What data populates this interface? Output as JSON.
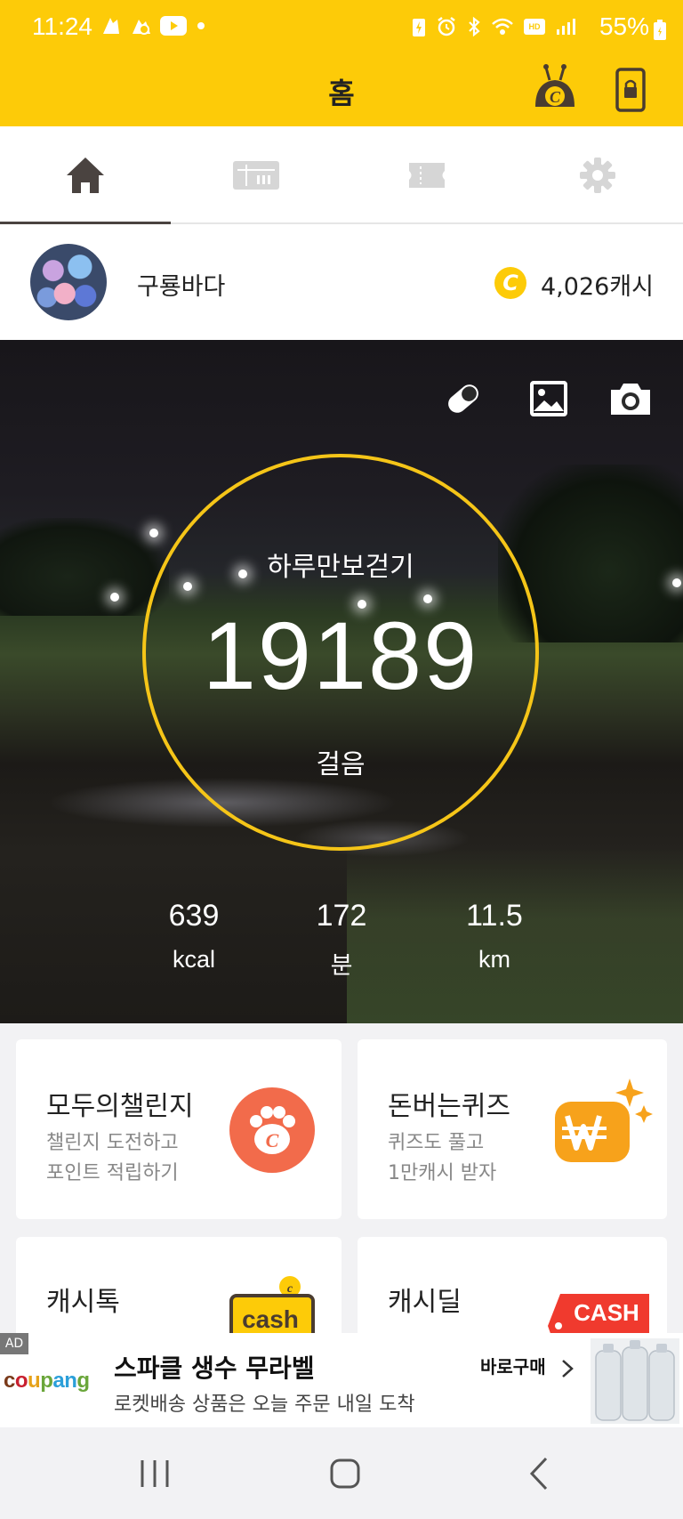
{
  "status_bar": {
    "time": "11:24",
    "battery": "55%"
  },
  "header": {
    "title": "홈"
  },
  "tabs": [
    {
      "name": "home",
      "icon": "home-icon",
      "active": true
    },
    {
      "name": "gift",
      "icon": "gift-card-icon",
      "active": false
    },
    {
      "name": "ticket",
      "icon": "ticket-icon",
      "active": false
    },
    {
      "name": "settings",
      "icon": "gear-icon",
      "active": false
    }
  ],
  "profile": {
    "username": "구룡바다",
    "coin_symbol": "C",
    "cash": "4,026캐시"
  },
  "pedometer": {
    "label": "하루만보걷기",
    "steps": "19189",
    "unit": "걸음",
    "stats": [
      {
        "value": "639",
        "unit": "kcal"
      },
      {
        "value": "172",
        "unit": "분"
      },
      {
        "value": "11.5",
        "unit": "km"
      }
    ]
  },
  "cards": [
    {
      "title": "모두의챌린지",
      "sub1": "챌린지 도전하고",
      "sub2": "포인트 적립하기"
    },
    {
      "title": "돈버는퀴즈",
      "sub1": "퀴즈도 풀고",
      "sub2": "1만캐시 받자"
    },
    {
      "title": "캐시톡",
      "sub1": "",
      "sub2": ""
    },
    {
      "title": "캐시딜",
      "sub1": "",
      "sub2": ""
    }
  ],
  "card_icons": {
    "cashtalk_text": "cash",
    "cashdeal_text": "CASH"
  },
  "ad": {
    "tag": "AD",
    "logo": "coupang",
    "title": "스파클 생수 무라벨",
    "subtitle": "로켓배송 상품은 오늘 주문 내일 도착",
    "cta": "바로구매"
  },
  "colors": {
    "brand_yellow": "#fdcb08",
    "ring_yellow": "#f5c518",
    "challenge_orange": "#f26b4b",
    "quiz_orange": "#f7a21b"
  }
}
